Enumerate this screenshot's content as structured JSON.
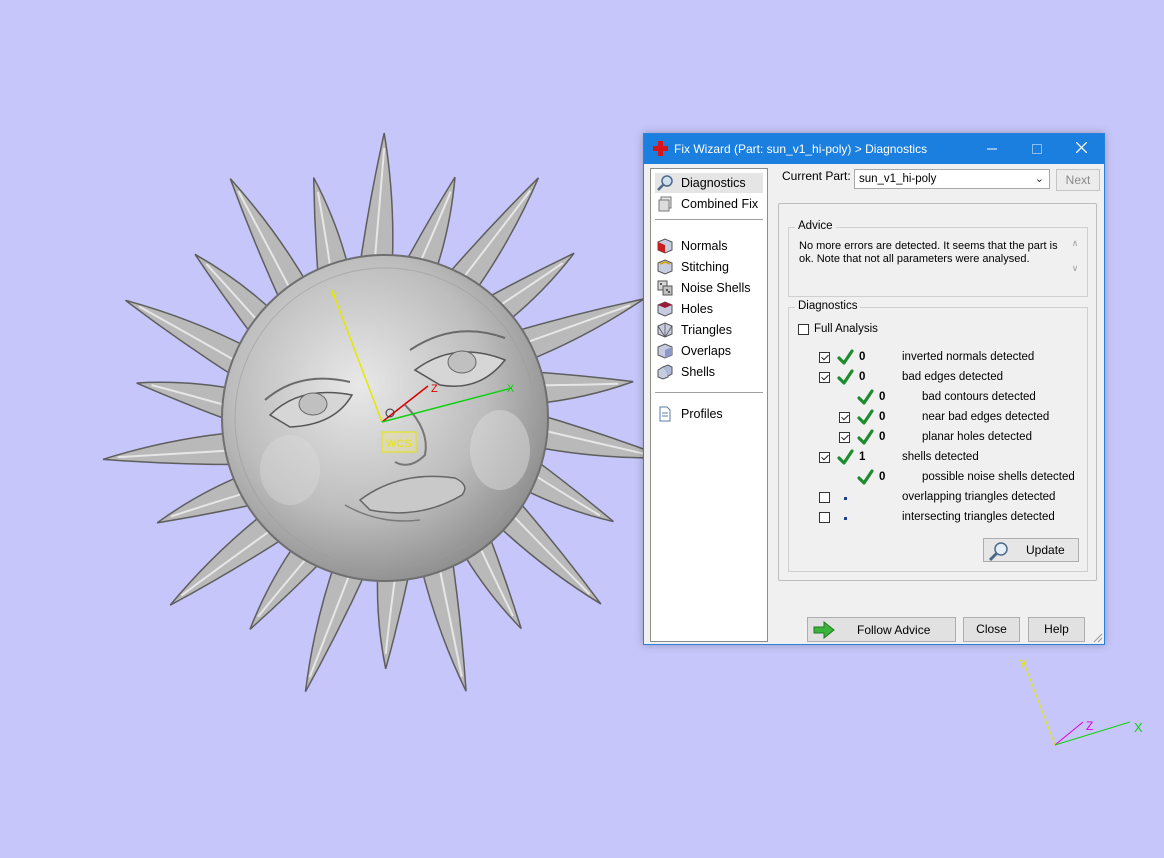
{
  "viewport": {
    "axis_labels": {
      "y": "Y",
      "z": "Z",
      "x": "X"
    },
    "gizmo_label": "WCS",
    "corner_axis_labels": {
      "y": "Y",
      "z": "Z",
      "x": "X"
    }
  },
  "dialog": {
    "title": "Fix Wizard (Part: sun_v1_hi-poly) > Diagnostics",
    "nav": {
      "items": [
        {
          "label": "Diagnostics",
          "icon": "magnifier-icon",
          "selected": true
        },
        {
          "label": "Combined Fix",
          "icon": "stack-icon"
        },
        {
          "label": "Normals",
          "icon": "cube-red-face-icon"
        },
        {
          "label": "Stitching",
          "icon": "cube-stitch-icon"
        },
        {
          "label": "Noise Shells",
          "icon": "dice-icon"
        },
        {
          "label": "Holes",
          "icon": "cube-hole-icon"
        },
        {
          "label": "Triangles",
          "icon": "cube-triangles-icon"
        },
        {
          "label": "Overlaps",
          "icon": "cube-overlap-icon"
        },
        {
          "label": "Shells",
          "icon": "shells-icon"
        },
        {
          "label": "Profiles",
          "icon": "document-icon"
        }
      ]
    },
    "current_part": {
      "label": "Current Part:",
      "value": "sun_v1_hi-poly"
    },
    "next_label": "Next",
    "advice": {
      "title": "Advice",
      "text": "No more errors are detected. It seems that the part is ok. Note that not all parameters were analysed."
    },
    "diagnostics": {
      "title": "Diagnostics",
      "full_analysis_label": "Full Analysis",
      "full_analysis_checked": false,
      "rows": [
        {
          "checked": true,
          "ok": true,
          "count": "0",
          "label": "inverted normals detected"
        },
        {
          "checked": true,
          "ok": true,
          "count": "0",
          "label": "bad edges detected"
        },
        {
          "ok": true,
          "count": "0",
          "label": "bad contours detected"
        },
        {
          "checked": true,
          "ok": true,
          "count": "0",
          "label": "near bad edges detected"
        },
        {
          "checked": true,
          "ok": true,
          "count": "0",
          "label": "planar holes detected"
        },
        {
          "checked": true,
          "ok": true,
          "count": "1",
          "label": "shells detected"
        },
        {
          "ok": true,
          "count": "0",
          "label": "possible noise shells detected"
        },
        {
          "checked": false,
          "label": "overlapping triangles detected"
        },
        {
          "checked": false,
          "label": "intersecting triangles detected"
        }
      ],
      "update_label": "Update"
    },
    "buttons": {
      "follow_advice": "Follow Advice",
      "close": "Close",
      "help": "Help"
    }
  }
}
